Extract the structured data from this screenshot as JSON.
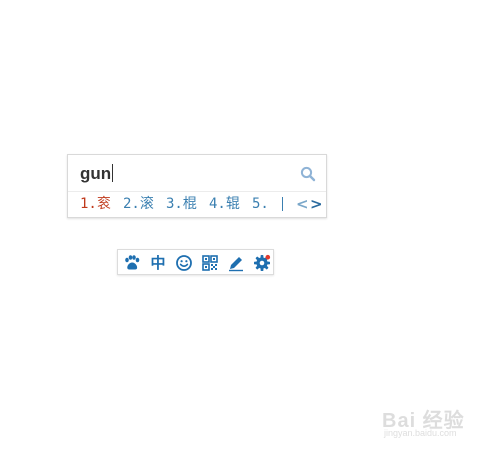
{
  "ime": {
    "composition": "gun",
    "candidates": [
      {
        "num": "1.",
        "text": "衮"
      },
      {
        "num": "2.",
        "text": "滚"
      },
      {
        "num": "3.",
        "text": "棍"
      },
      {
        "num": "4.",
        "text": "辊"
      },
      {
        "num": "5.",
        "text": ""
      }
    ],
    "prev_symbol": "<",
    "next_symbol": ">",
    "active_color": "#c0391b",
    "candidate_color": "#3a7fb0",
    "search_icon": "search-icon"
  },
  "toolbar": {
    "zh_label": "中",
    "icons": [
      "paw-icon",
      "chinese-mode-icon",
      "emoji-icon",
      "keyboard-grid-icon",
      "pen-icon",
      "gear-icon"
    ],
    "accent": "#1e6fb0",
    "notification_dot": "#e03a2f"
  },
  "watermark": {
    "text": "Bai 经验",
    "sub": "jingyan.baidu.com"
  }
}
